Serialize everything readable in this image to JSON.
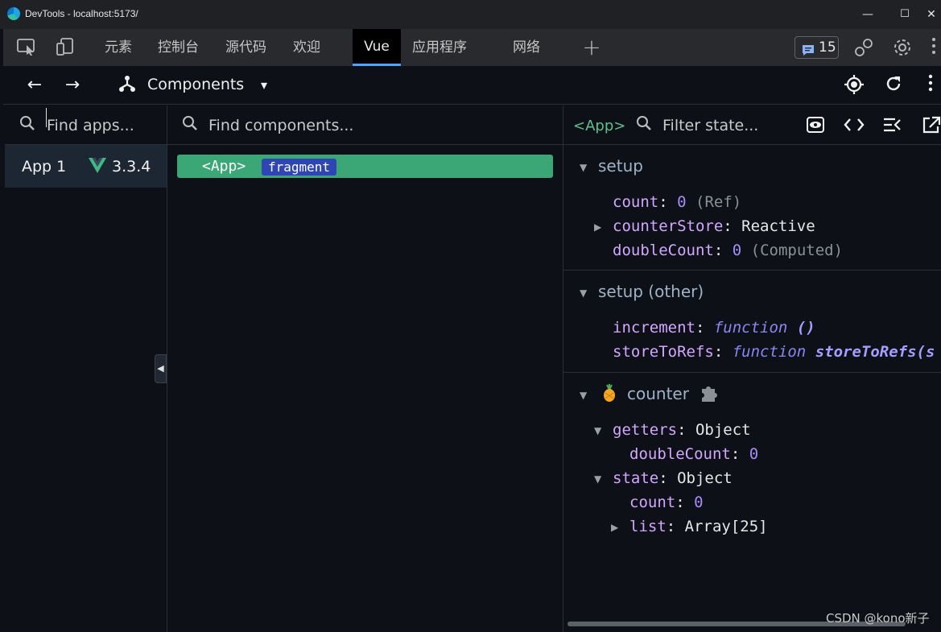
{
  "window": {
    "title": "DevTools - localhost:5173/",
    "minimize": "—",
    "maximize": "☐",
    "close": "✕"
  },
  "devtools_tabs": {
    "tabs": [
      "元素",
      "控制台",
      "源代码",
      "欢迎",
      "Vue",
      "应用程序",
      "网络"
    ],
    "active": "Vue",
    "add": "+",
    "issues_count": "15"
  },
  "vue_toolbar": {
    "back": "←",
    "forward": "→",
    "view_label": "Components",
    "dropdown": "▾"
  },
  "apps": {
    "search_placeholder": "Find apps...",
    "items": [
      {
        "name": "App 1",
        "version": "3.3.4"
      }
    ]
  },
  "components": {
    "search_placeholder": "Find components...",
    "tree": [
      {
        "tag": "<App>",
        "badge": "fragment"
      }
    ]
  },
  "inspector": {
    "selected_tag": "<App>",
    "filter_placeholder": "Filter state...",
    "sections": {
      "setup": {
        "title": "setup",
        "rows": [
          {
            "key": "count",
            "value": "0",
            "note": "(Ref)"
          },
          {
            "key": "counterStore",
            "value": "Reactive"
          },
          {
            "key": "doubleCount",
            "value": "0",
            "note": "(Computed)"
          }
        ]
      },
      "setup_other": {
        "title": "setup (other)",
        "rows": [
          {
            "key": "increment",
            "fn": "function",
            "fn_sig": "()"
          },
          {
            "key": "storeToRefs",
            "fn": "function",
            "fn_sig": "storeToRefs(s"
          }
        ]
      },
      "counter": {
        "title": "counter",
        "getters_key": "getters",
        "getters_value": "Object",
        "getters_child_key": "doubleCount",
        "getters_child_value": "0",
        "state_key": "state",
        "state_value": "Object",
        "state_child1_key": "count",
        "state_child1_value": "0",
        "state_child2_key": "list",
        "state_child2_value": "Array[25]"
      }
    }
  },
  "watermark": "CSDN @kono新子"
}
